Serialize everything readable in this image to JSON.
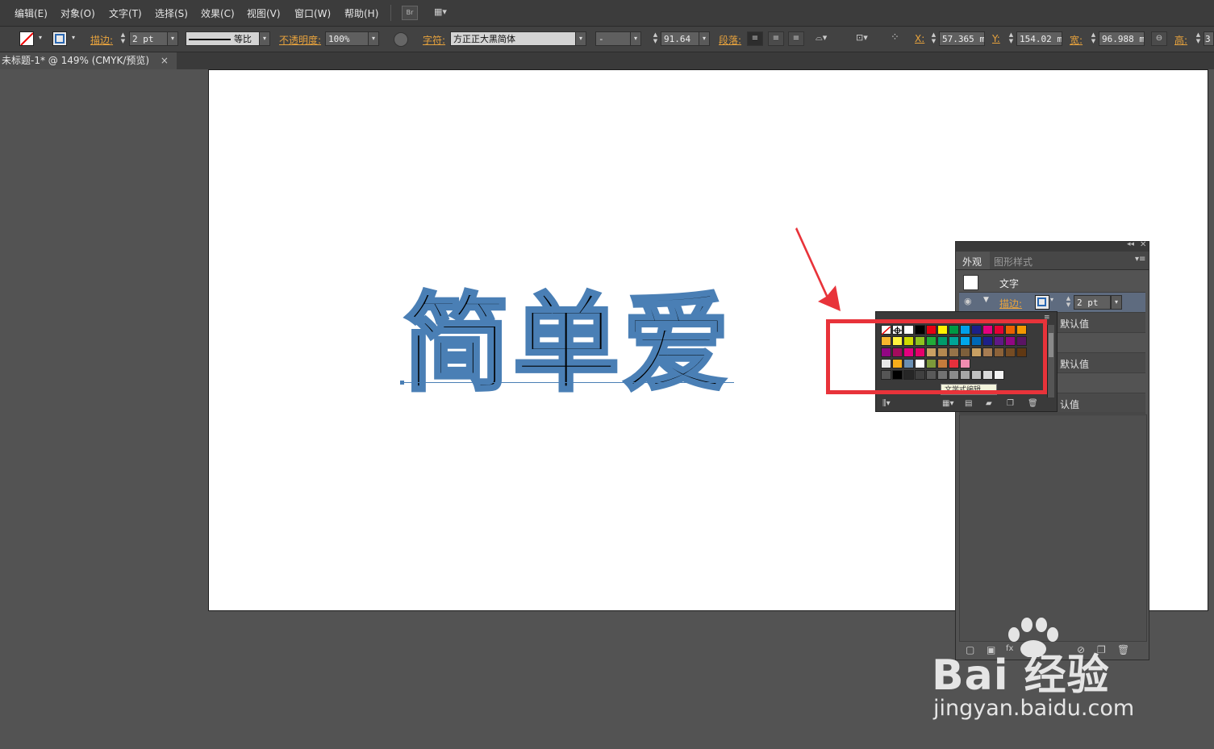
{
  "menubar": {
    "items": [
      "编辑(E)",
      "对象(O)",
      "文字(T)",
      "选择(S)",
      "效果(C)",
      "视图(V)",
      "窗口(W)",
      "帮助(H)"
    ],
    "bridge_label": "Br"
  },
  "controlbar": {
    "stroke_label": "描边:",
    "stroke_weight": "2 pt",
    "stroke_profile": "等比",
    "opacity_label": "不透明度:",
    "opacity_value": "100%",
    "character_label": "字符:",
    "font_family": "方正正大黑简体",
    "font_style": "-",
    "font_size": "91.64",
    "paragraph_label": "段落:",
    "x_label": "X:",
    "x_value": "57.365 mm",
    "y_label": "Y:",
    "y_value": "154.02 mm",
    "w_label": "宽:",
    "w_value": "96.988 mm",
    "h_label": "高:",
    "h_value": "3"
  },
  "document": {
    "tab_title": "未标题-1* @ 149% (CMYK/预览)",
    "close_glyph": "×",
    "art_text": "简单爱"
  },
  "appearance_panel": {
    "tabs": [
      "外观",
      "图形样式"
    ],
    "object_type": "文字",
    "stroke_label": "描边:",
    "stroke_weight": "2 pt",
    "default_value_1": "默认值",
    "default_value_2": "默认值",
    "default_value_3": "认值"
  },
  "swatch_popup": {
    "tooltip": "文学式编辑"
  },
  "watermark": {
    "brand": "Bai 经验",
    "url": "jingyan.baidu.com"
  },
  "colors": {
    "highlight": "#e8333a",
    "stroke_blue": "#4a7fb5",
    "label_orange": "#e8a33d"
  }
}
